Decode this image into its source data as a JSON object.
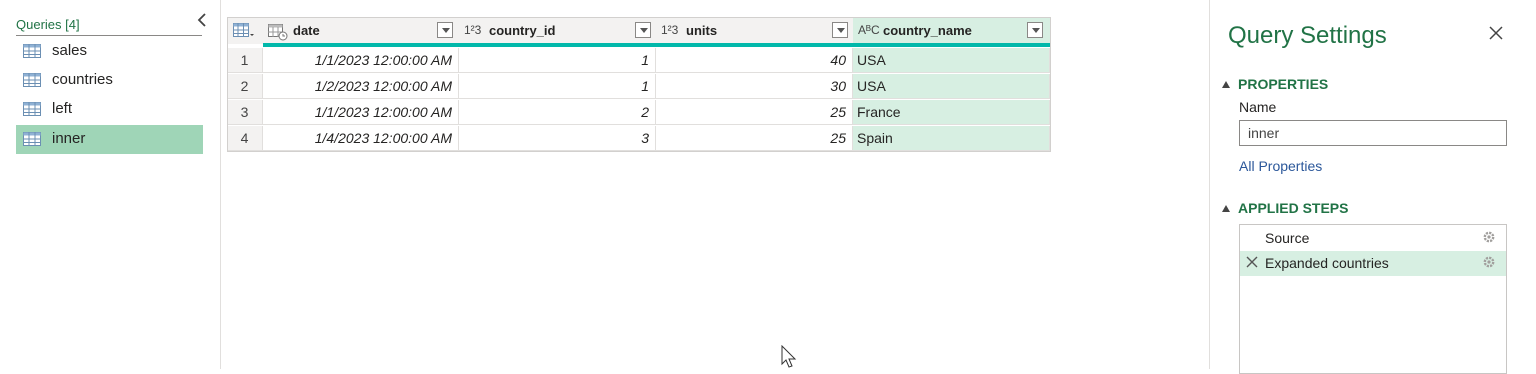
{
  "queries": {
    "title": "Queries [4]",
    "items": [
      {
        "label": "sales"
      },
      {
        "label": "countries"
      },
      {
        "label": "left"
      },
      {
        "label": "inner"
      }
    ],
    "selected": "inner"
  },
  "grid": {
    "columns": [
      {
        "type_icon": "calendar-clock-icon",
        "type_text": "",
        "label": "date"
      },
      {
        "type_icon": "whole-number-icon",
        "type_text": "1²3",
        "label": "country_id"
      },
      {
        "type_icon": "whole-number-icon",
        "type_text": "1²3",
        "label": "units"
      },
      {
        "type_icon": "text-type-icon",
        "type_text": "AᴮC",
        "label": "country_name"
      }
    ],
    "rows": [
      {
        "n": "1",
        "date": "1/1/2023 12:00:00 AM",
        "country_id": "1",
        "units": "40",
        "country_name": "USA"
      },
      {
        "n": "2",
        "date": "1/2/2023 12:00:00 AM",
        "country_id": "1",
        "units": "30",
        "country_name": "USA"
      },
      {
        "n": "3",
        "date": "1/1/2023 12:00:00 AM",
        "country_id": "2",
        "units": "25",
        "country_name": "France"
      },
      {
        "n": "4",
        "date": "1/4/2023 12:00:00 AM",
        "country_id": "3",
        "units": "25",
        "country_name": "Spain"
      }
    ]
  },
  "settings": {
    "title": "Query Settings",
    "properties_heading": "PROPERTIES",
    "name_label": "Name",
    "name_value": "inner",
    "all_properties": "All Properties",
    "applied_steps_heading": "APPLIED STEPS",
    "steps": [
      {
        "label": "Source"
      },
      {
        "label": "Expanded countries"
      }
    ]
  },
  "colors": {
    "accent_green": "#217346",
    "selected_query": "#9fd5b7",
    "selected_column": "#d7efe2",
    "quality_bar": "#01b8aa"
  }
}
